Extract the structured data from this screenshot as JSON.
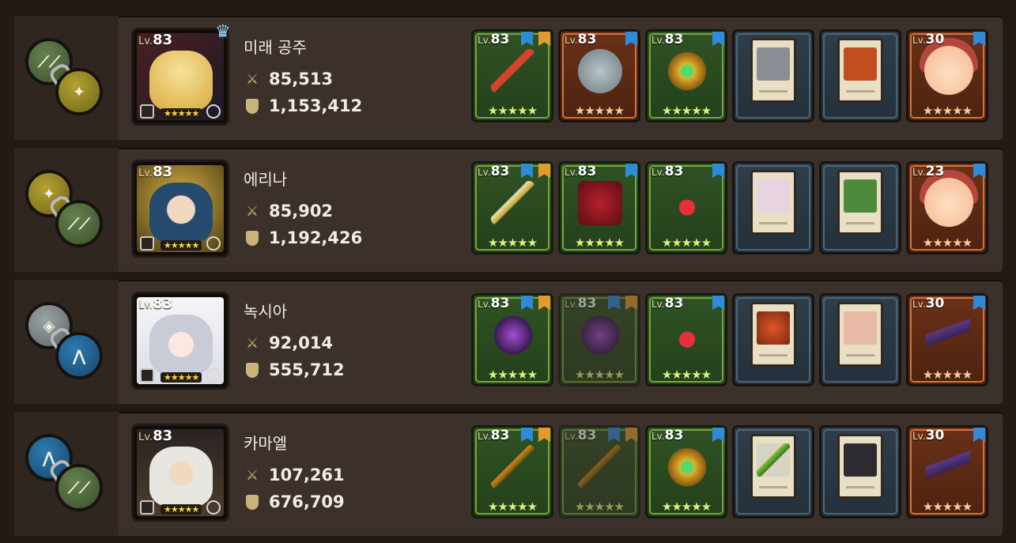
{
  "colors": {
    "row_bg": "#3b302a",
    "accent_gold": "#c9b27b",
    "star": "#ffd33b"
  },
  "rows": [
    {
      "name": "미래 공주",
      "level": "83",
      "attack": "85,513",
      "defense": "1,153,412",
      "crown": true,
      "chain": [
        "green",
        "olive"
      ],
      "slots": [
        {
          "type": "green",
          "level": "83",
          "icon": "red-spear-icon",
          "stars": "★★★★★"
        },
        {
          "type": "orange",
          "level": "83",
          "icon": "silver-shield-icon",
          "stars": "★★★★★"
        },
        {
          "type": "green",
          "level": "83",
          "icon": "green-gem-amulet-icon",
          "stars": "★★★★★"
        },
        {
          "type": "navy",
          "level": "",
          "icon": "old-man-card-icon",
          "stars": ""
        },
        {
          "type": "navy",
          "level": "",
          "icon": "fire-hero-card-icon",
          "stars": ""
        },
        {
          "type": "orange",
          "level": "30",
          "icon": "smiling-girl-icon",
          "stars": "★★★★★"
        }
      ]
    },
    {
      "name": "에리나",
      "level": "83",
      "attack": "85,902",
      "defense": "1,192,426",
      "crown": false,
      "chain": [
        "olive",
        "green"
      ],
      "slots": [
        {
          "type": "green",
          "level": "83",
          "icon": "golden-sword-icon",
          "stars": "★★★★★"
        },
        {
          "type": "green",
          "level": "83",
          "icon": "crimson-armor-icon",
          "stars": "★★★★★"
        },
        {
          "type": "green",
          "level": "83",
          "icon": "ruby-necklace-icon",
          "stars": "★★★★★"
        },
        {
          "type": "navy",
          "level": "",
          "icon": "white-cat-card-icon",
          "stars": ""
        },
        {
          "type": "navy",
          "level": "",
          "icon": "goblin-officer-card-icon",
          "stars": ""
        },
        {
          "type": "orange",
          "level": "23",
          "icon": "smiling-girl-icon",
          "stars": "★★★★★"
        }
      ]
    },
    {
      "name": "녹시아",
      "level": "83",
      "attack": "92,014",
      "defense": "555,712",
      "crown": false,
      "chain": [
        "gray",
        "blue"
      ],
      "slots": [
        {
          "type": "green",
          "level": "83",
          "icon": "purple-orb-icon",
          "stars": "★★★★★",
          "dim": false
        },
        {
          "type": "green",
          "level": "83",
          "icon": "purple-orb-icon",
          "stars": "★★★★★",
          "dim": true
        },
        {
          "type": "green",
          "level": "83",
          "icon": "ruby-necklace-icon",
          "stars": "★★★★★"
        },
        {
          "type": "navy",
          "level": "",
          "icon": "red-lantern-card-icon",
          "stars": ""
        },
        {
          "type": "navy",
          "level": "",
          "icon": "fox-mask-card-icon",
          "stars": ""
        },
        {
          "type": "orange",
          "level": "30",
          "icon": "purple-weapon-stand-icon",
          "stars": "★★★★★"
        }
      ]
    },
    {
      "name": "카마엘",
      "level": "83",
      "attack": "107,261",
      "defense": "676,709",
      "crown": false,
      "chain": [
        "blue",
        "green"
      ],
      "slots": [
        {
          "type": "green",
          "level": "83",
          "icon": "golden-scythe-icon",
          "stars": "★★★★★",
          "dim": false
        },
        {
          "type": "green",
          "level": "83",
          "icon": "golden-scythe-icon",
          "stars": "★★★★★",
          "dim": true
        },
        {
          "type": "green",
          "level": "83",
          "icon": "green-gem-amulet-icon",
          "stars": "★★★★★"
        },
        {
          "type": "navy",
          "level": "",
          "icon": "green-dagger-card-icon",
          "stars": ""
        },
        {
          "type": "navy",
          "level": "",
          "icon": "top-hat-man-card-icon",
          "stars": ""
        },
        {
          "type": "orange",
          "level": "30",
          "icon": "purple-weapon-stand-icon",
          "stars": "★★★★★"
        }
      ]
    }
  ],
  "labels": {
    "lv_prefix": "Lv.",
    "hero_stars": "★★★★★"
  }
}
